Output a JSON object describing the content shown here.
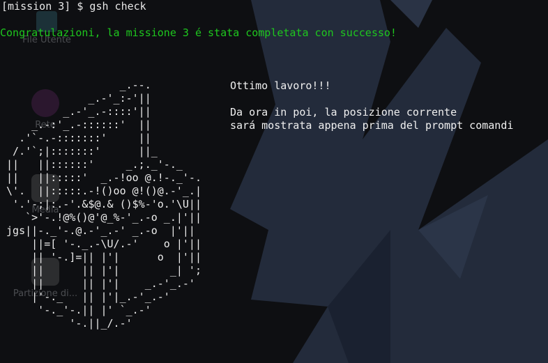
{
  "desktop": {
    "icons": [
      {
        "label": "File Utente",
        "icon": "home-folder-icon"
      },
      {
        "label": "Rete",
        "icon": "network-icon"
      },
      {
        "label": "Media",
        "icon": "drive-icon"
      },
      {
        "label": "Partizione di...",
        "icon": "partition-icon"
      }
    ]
  },
  "terminal": {
    "prompt_line": "[mission 3] $ gsh check",
    "success_line": "Congratulazioni, la missione 3 é stata completata con successo!",
    "message_lines": [
      "Ottimo lavoro!!!",
      "",
      "Da ora in poi, la posizione corrente",
      "sará mostrata appena prima del prompt comandi"
    ],
    "ascii_art": "                   _.--.\n              _.-'_:-'||\n          _.-'_.-::::'||\n     _.-:'_.-::::::'  ||\n   .'`-.-:::::::'     ||\n  /.'`;|:::::::'      ||_\n ||   ||::::::'     _.;._'-._\n ||   ||:::::'  _.-!oo @.!-._'-.\n \\'.  ||:::::.-!()oo @!()@.-'_.|\n  '.'-;|:.-'.&$@.& ()$%-'o.'\\U||\n    `>'-.!@%()@'@_%-'_.-o _.|'||\n jgs||-._'-.@.-'_.-' _.-o  |'||\n     ||=[ '-._.-\\U/.-'    o |'||\n     || '-.]=|| |'|      o  |'||\n     ||      || |'|        _| ';\n     ||      || |'|    _.-'_.-'\n     |'-._   || |'|_.-'_.-'\n      '-._'-.|| |' `_.-'\n           '-.||_/.-'",
    "colors": {
      "prompt": "#e8e8e8",
      "success": "#1ec71e",
      "text": "#f0f0f0",
      "background": "#0e0f12"
    }
  }
}
